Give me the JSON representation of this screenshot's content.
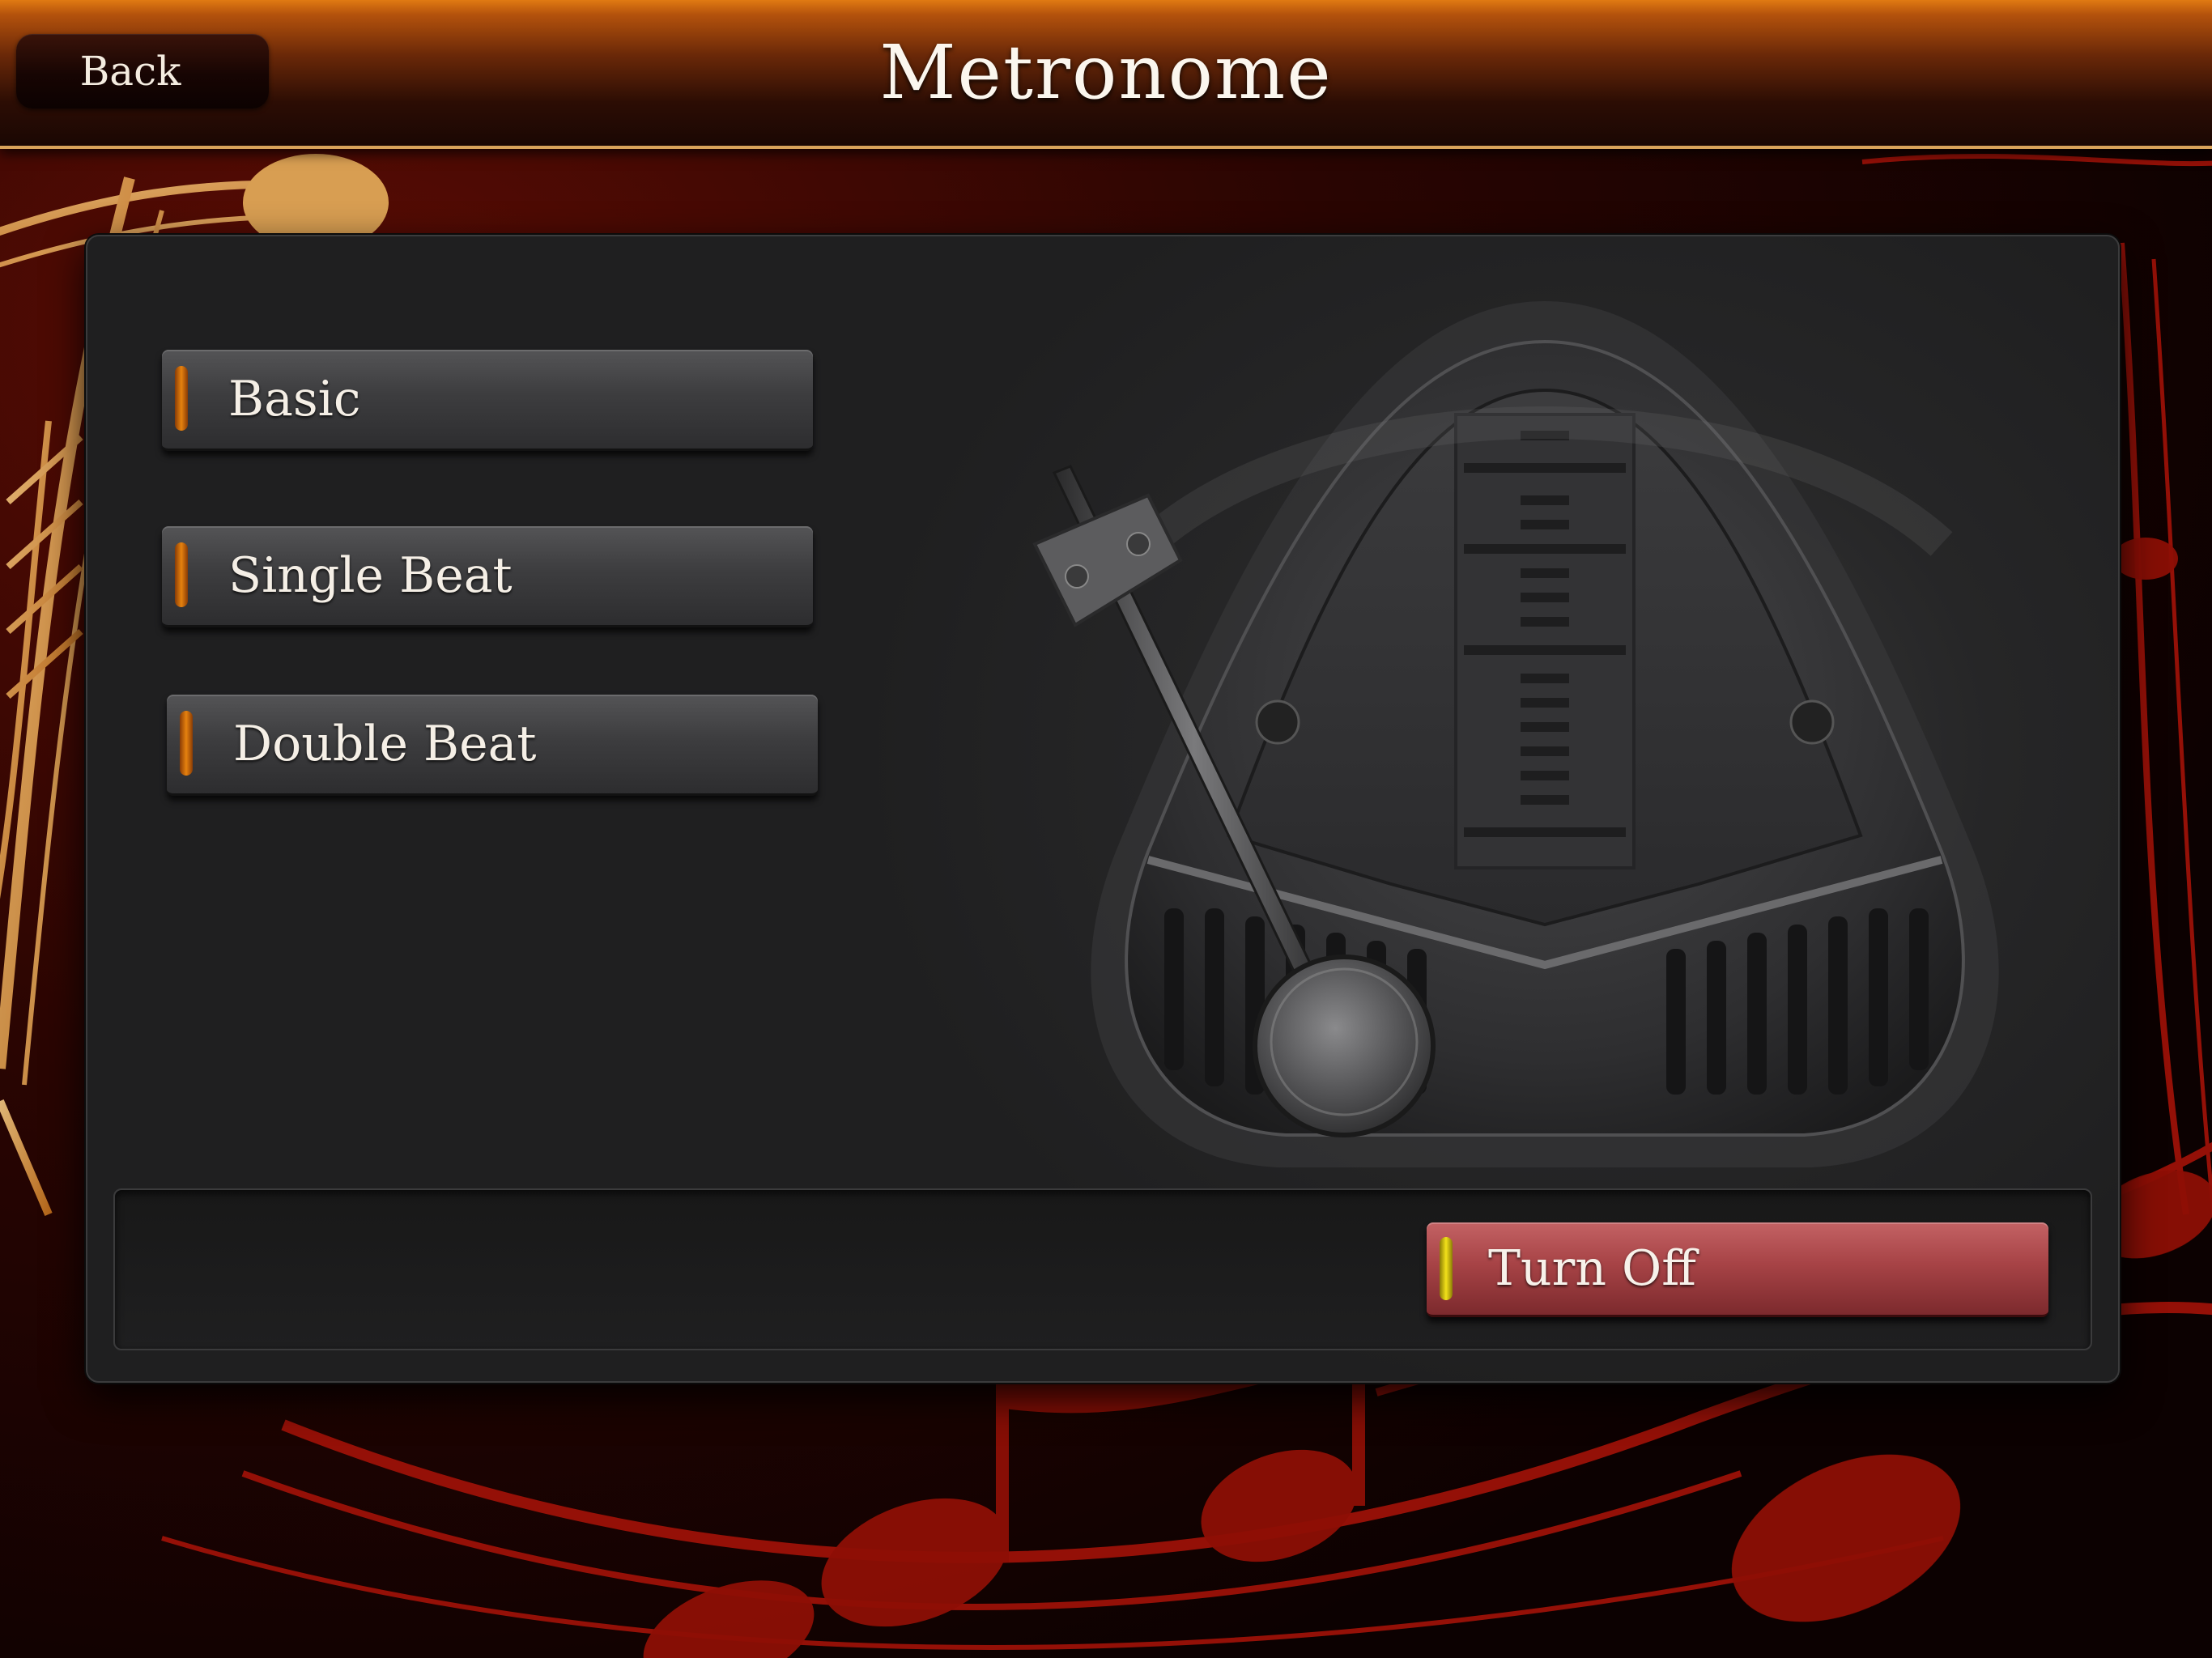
{
  "header": {
    "back_label": "Back",
    "title": "Metronome"
  },
  "modes": {
    "basic_label": "Basic",
    "single_label": "Single Beat",
    "double_label": "Double Beat"
  },
  "footer": {
    "turn_off_label": "Turn Off"
  },
  "colors": {
    "header_orange": "#e07a12",
    "mode_indicator": "#e6820f",
    "turn_off_red": "#a74346",
    "turn_off_indicator": "#f2e11a",
    "background_music_red": "#a31208"
  },
  "icons": {
    "background": "music-notes-art",
    "metronome": "metronome-icon"
  }
}
